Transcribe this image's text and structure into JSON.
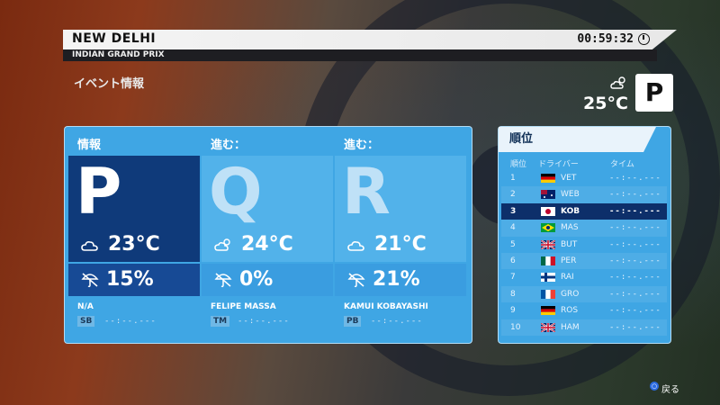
{
  "header": {
    "city": "NEW DELHI",
    "event": "INDIAN GRAND PRIX",
    "clock": "00:59:32"
  },
  "event_info_label": "イベント情報",
  "current": {
    "temp": "25°C",
    "session": "P",
    "icon": "sun-cloud-icon"
  },
  "sessions": [
    {
      "title": "情報",
      "letter": "P",
      "temp": "23°C",
      "rain": "15%",
      "weather_icon": "cloud-icon",
      "player": "N/A",
      "tag": "SB",
      "time": "--:--.---"
    },
    {
      "title": "進む：",
      "letter": "Q",
      "temp": "24°C",
      "rain": "0%",
      "weather_icon": "sun-cloud-icon",
      "player": "FELIPE MASSA",
      "tag": "TM",
      "time": "--:--.---"
    },
    {
      "title": "進む：",
      "letter": "R",
      "temp": "21°C",
      "rain": "21%",
      "weather_icon": "cloud-icon",
      "player": "KAMUI KOBAYASHI",
      "tag": "PB",
      "time": "--:--.---"
    }
  ],
  "standings": {
    "title": "順位",
    "headers": {
      "pos": "順位",
      "driver": "ドライバー",
      "time": "タイム"
    },
    "selected_index": 2,
    "rows": [
      {
        "pos": "1",
        "flag": "germany",
        "driver": "VET",
        "time": "--:--.---"
      },
      {
        "pos": "2",
        "flag": "australia",
        "driver": "WEB",
        "time": "--:--.---"
      },
      {
        "pos": "3",
        "flag": "japan",
        "driver": "KOB",
        "time": "--:--.---"
      },
      {
        "pos": "4",
        "flag": "brazil",
        "driver": "MAS",
        "time": "--:--.---"
      },
      {
        "pos": "5",
        "flag": "uk",
        "driver": "BUT",
        "time": "--:--.---"
      },
      {
        "pos": "6",
        "flag": "mexico",
        "driver": "PER",
        "time": "--:--.---"
      },
      {
        "pos": "7",
        "flag": "finland",
        "driver": "RAI",
        "time": "--:--.---"
      },
      {
        "pos": "8",
        "flag": "france",
        "driver": "GRO",
        "time": "--:--.---"
      },
      {
        "pos": "9",
        "flag": "germany",
        "driver": "ROS",
        "time": "--:--.---"
      },
      {
        "pos": "10",
        "flag": "uk",
        "driver": "HAM",
        "time": "--:--.---"
      }
    ]
  },
  "footer": {
    "back_label": "戻る",
    "back_button": "circle-button-icon"
  },
  "colors": {
    "panel": "#3fa6e4",
    "dark_tile": "#0f3a7a",
    "highlight_row": "#0d2f6a"
  }
}
